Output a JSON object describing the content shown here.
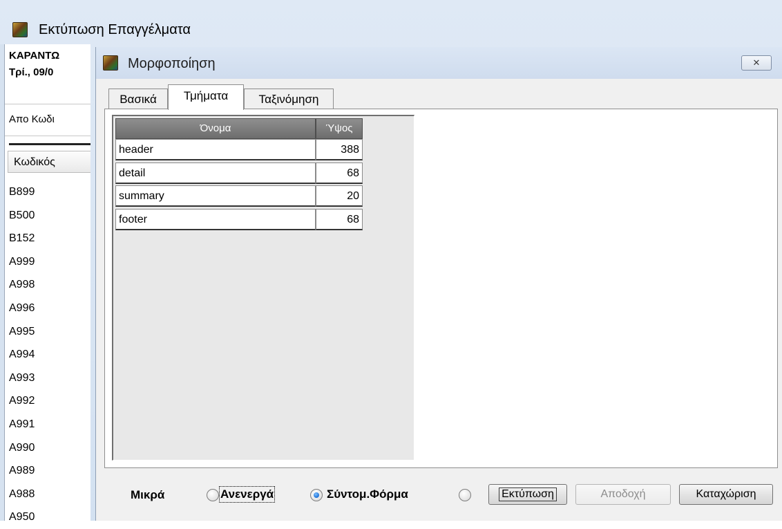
{
  "outer_window": {
    "title": "Εκτύπωση Επαγγέλματα",
    "company_text": "ΚΑΡΑΝΤΩ",
    "date_text": "Τρί., 09/0",
    "from_code_label": "Απο Κωδι",
    "code_column_header": "Κωδικός",
    "codes": [
      "B899",
      "B500",
      "B152",
      "A999",
      "A998",
      "A996",
      "A995",
      "A994",
      "A993",
      "A992",
      "A991",
      "A990",
      "A989",
      "A988",
      "A950"
    ]
  },
  "dialog": {
    "title": "Μορφοποίηση",
    "close_icon": "close-icon",
    "tabs": [
      {
        "label": "Βασικά",
        "active": false
      },
      {
        "label": "Τμήματα",
        "active": true
      },
      {
        "label": "Ταξινόμηση",
        "active": false
      }
    ],
    "grid": {
      "columns": [
        "Όνομα",
        "Ύψος"
      ],
      "rows": [
        {
          "name": "header",
          "height": "388"
        },
        {
          "name": "detail",
          "height": "68"
        },
        {
          "name": "summary",
          "height": "20"
        },
        {
          "name": "footer",
          "height": "68"
        }
      ]
    },
    "bottom": {
      "small_label": "Μικρά",
      "radios": [
        {
          "label": "Ανενεργά",
          "checked": false
        },
        {
          "label": "Σύντομ.Φόρμα",
          "checked": true
        },
        {
          "label": "",
          "checked": false
        }
      ],
      "buttons": {
        "print": "Εκτύπωση",
        "accept": "Αποδοχή",
        "register": "Καταχώριση"
      }
    }
  }
}
